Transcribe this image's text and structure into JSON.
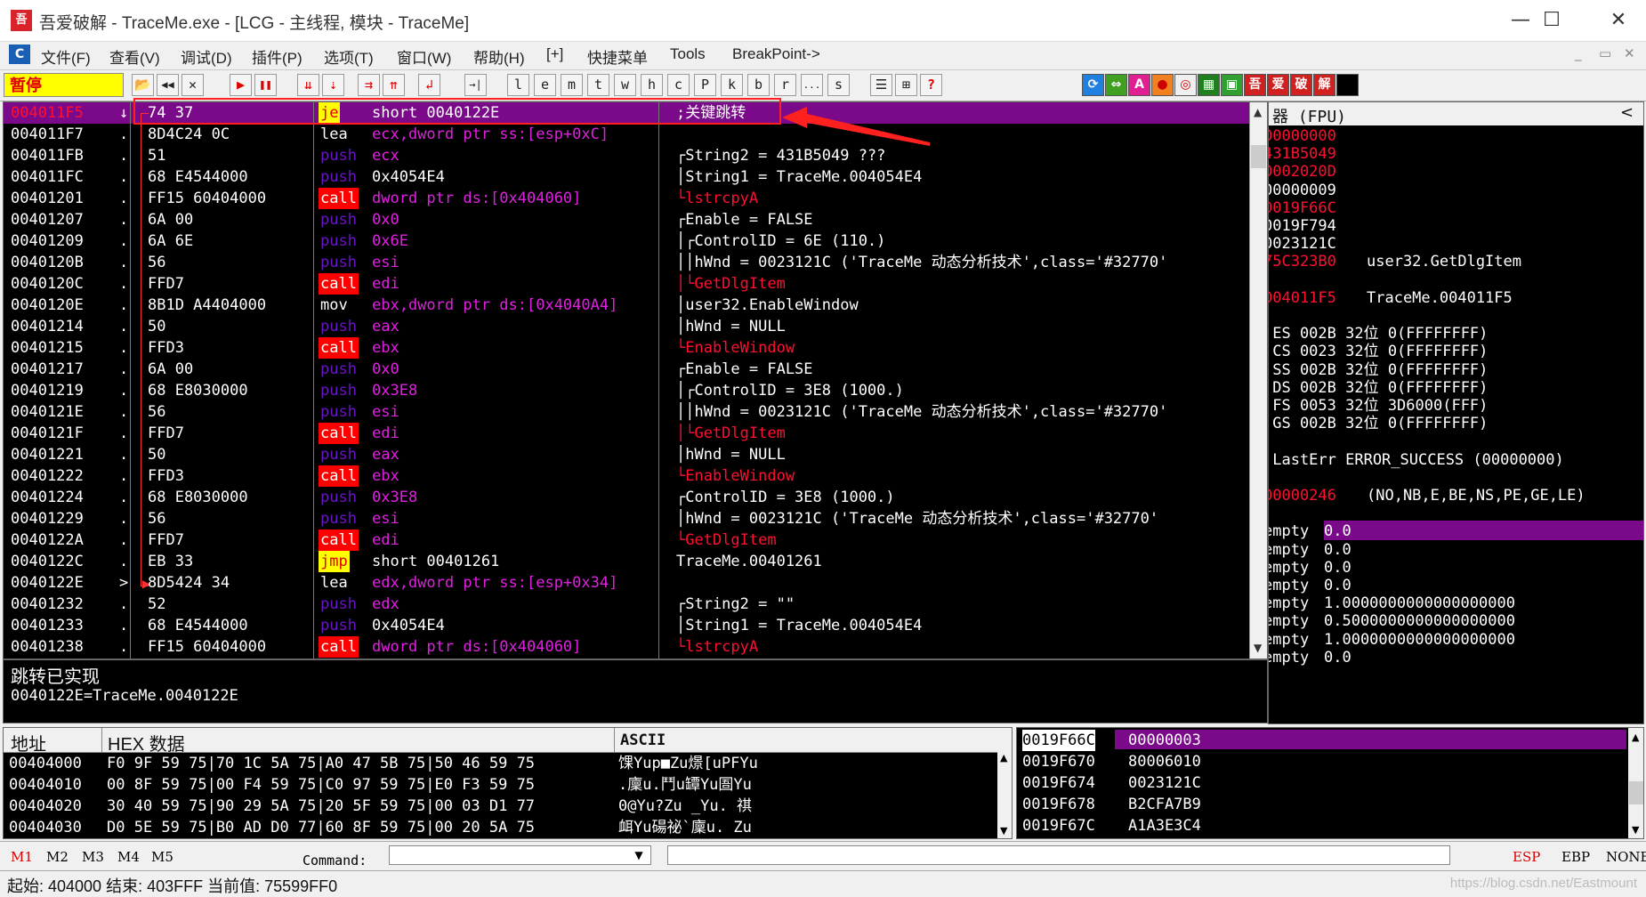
{
  "window": {
    "title": "吾爱破解 - TraceMe.exe - [LCG - 主线程, 模块 - TraceMe]",
    "icon": "吾",
    "minimize": "—",
    "maximize": "☐",
    "close": "✕"
  },
  "menu": {
    "logo": "C",
    "items": [
      "文件(F)",
      "查看(V)",
      "调试(D)",
      "插件(P)",
      "选项(T)",
      "窗口(W)",
      "帮助(H)",
      "[+]",
      "快捷菜单",
      "Tools",
      "BreakPoint->"
    ],
    "mdi": [
      "_",
      "▭",
      "✕"
    ]
  },
  "toolbar": {
    "status": "暂停",
    "buttons": [
      "📂",
      "◀◀",
      "✕",
      "▶",
      "❚❚",
      "⇊",
      "⇣",
      "⇉",
      "⇈",
      "↲",
      "→|"
    ],
    "letters": [
      "l",
      "e",
      "m",
      "t",
      "w",
      "h",
      "c",
      "P",
      "k",
      "b",
      "r",
      "...",
      "s"
    ],
    "right_buttons": [
      "☰",
      "⊞",
      "?"
    ],
    "plugins": [
      "⟳",
      "⇔",
      "A",
      "●",
      "◎",
      "▦",
      "▣",
      "吾",
      "爱",
      "破",
      "解",
      ""
    ]
  },
  "disasm": {
    "rows": [
      {
        "addr": "004011F5",
        "mark": "↓",
        "hex": "74 37",
        "mn": "je",
        "mk": "jcc",
        "op": "short 0040122E",
        "ok": "white",
        "cm": ";关键跳转",
        "ck": "white"
      },
      {
        "addr": "004011F7",
        "mark": ".",
        "hex": "8D4C24 0C",
        "mn": "lea",
        "mk": "lea",
        "op": "ecx,dword ptr ss:[esp+0xC]",
        "ok": "push",
        "cm": "",
        "ck": "white"
      },
      {
        "addr": "004011FB",
        "mark": ".",
        "hex": "51",
        "mn": "push",
        "mk": "push",
        "op": "ecx",
        "ok": "push",
        "cm": "┌String2 = 431B5049 ???",
        "ck": "white"
      },
      {
        "addr": "004011FC",
        "mark": ".",
        "hex": "68 E4544000",
        "mn": "push",
        "mk": "push",
        "op": "0x4054E4",
        "ok": "white",
        "cm": "│String1 = TraceMe.004054E4",
        "ck": "white"
      },
      {
        "addr": "00401201",
        "mark": ".",
        "hex": "FF15 60404000",
        "mn": "call",
        "mk": "call",
        "op": "dword ptr ds:[0x404060]",
        "ok": "push",
        "cm": "└lstrcpyA",
        "ck": "red"
      },
      {
        "addr": "00401207",
        "mark": ".",
        "hex": "6A 00",
        "mn": "push",
        "mk": "push",
        "op": "0x0",
        "ok": "push",
        "cm": "┌Enable = FALSE",
        "ck": "white"
      },
      {
        "addr": "00401209",
        "mark": ".",
        "hex": "6A 6E",
        "mn": "push",
        "mk": "push",
        "op": "0x6E",
        "ok": "push",
        "cm": "│┌ControlID = 6E (110.)",
        "ck": "white"
      },
      {
        "addr": "0040120B",
        "mark": ".",
        "hex": "56",
        "mn": "push",
        "mk": "push",
        "op": "esi",
        "ok": "push",
        "cm": "││hWnd = 0023121C ('TraceMe 动态分析技术',class='#32770'",
        "ck": "white"
      },
      {
        "addr": "0040120C",
        "mark": ".",
        "hex": "FFD7",
        "mn": "call",
        "mk": "call",
        "op": "edi",
        "ok": "push",
        "cm": "│└GetDlgItem",
        "ck": "red"
      },
      {
        "addr": "0040120E",
        "mark": ".",
        "hex": "8B1D A4404000",
        "mn": "mov",
        "mk": "mov",
        "op": "ebx,dword ptr ds:[0x4040A4]",
        "ok": "push",
        "cm": "│user32.EnableWindow",
        "ck": "white"
      },
      {
        "addr": "00401214",
        "mark": ".",
        "hex": "50",
        "mn": "push",
        "mk": "push",
        "op": "eax",
        "ok": "push",
        "cm": "│hWnd = NULL",
        "ck": "white"
      },
      {
        "addr": "00401215",
        "mark": ".",
        "hex": "FFD3",
        "mn": "call",
        "mk": "call",
        "op": "ebx",
        "ok": "push",
        "cm": "└EnableWindow",
        "ck": "red"
      },
      {
        "addr": "00401217",
        "mark": ".",
        "hex": "6A 00",
        "mn": "push",
        "mk": "push",
        "op": "0x0",
        "ok": "push",
        "cm": "┌Enable = FALSE",
        "ck": "white"
      },
      {
        "addr": "00401219",
        "mark": ".",
        "hex": "68 E8030000",
        "mn": "push",
        "mk": "push",
        "op": "0x3E8",
        "ok": "push",
        "cm": "│┌ControlID = 3E8 (1000.)",
        "ck": "white"
      },
      {
        "addr": "0040121E",
        "mark": ".",
        "hex": "56",
        "mn": "push",
        "mk": "push",
        "op": "esi",
        "ok": "push",
        "cm": "││hWnd = 0023121C ('TraceMe 动态分析技术',class='#32770'",
        "ck": "white"
      },
      {
        "addr": "0040121F",
        "mark": ".",
        "hex": "FFD7",
        "mn": "call",
        "mk": "call",
        "op": "edi",
        "ok": "push",
        "cm": "│└GetDlgItem",
        "ck": "red"
      },
      {
        "addr": "00401221",
        "mark": ".",
        "hex": "50",
        "mn": "push",
        "mk": "push",
        "op": "eax",
        "ok": "push",
        "cm": "│hWnd = NULL",
        "ck": "white"
      },
      {
        "addr": "00401222",
        "mark": ".",
        "hex": "FFD3",
        "mn": "call",
        "mk": "call",
        "op": "ebx",
        "ok": "push",
        "cm": "└EnableWindow",
        "ck": "red"
      },
      {
        "addr": "00401224",
        "mark": ".",
        "hex": "68 E8030000",
        "mn": "push",
        "mk": "push",
        "op": "0x3E8",
        "ok": "push",
        "cm": "┌ControlID = 3E8 (1000.)",
        "ck": "white"
      },
      {
        "addr": "00401229",
        "mark": ".",
        "hex": "56",
        "mn": "push",
        "mk": "push",
        "op": "esi",
        "ok": "push",
        "cm": "│hWnd = 0023121C ('TraceMe 动态分析技术',class='#32770'",
        "ck": "white"
      },
      {
        "addr": "0040122A",
        "mark": ".",
        "hex": "FFD7",
        "mn": "call",
        "mk": "call",
        "op": "edi",
        "ok": "push",
        "cm": "└GetDlgItem",
        "ck": "red"
      },
      {
        "addr": "0040122C",
        "mark": ".",
        "hex": "EB 33",
        "mn": "jmp",
        "mk": "jmp",
        "op": "short 00401261",
        "ok": "white",
        "cm": "TraceMe.00401261",
        "ck": "white"
      },
      {
        "addr": "0040122E",
        "mark": ">",
        "hex": "8D5424 34",
        "mn": "lea",
        "mk": "lea",
        "op": "edx,dword ptr ss:[esp+0x34]",
        "ok": "push",
        "cm": "",
        "ck": "white"
      },
      {
        "addr": "00401232",
        "mark": ".",
        "hex": "52",
        "mn": "push",
        "mk": "push",
        "op": "edx",
        "ok": "push",
        "cm": "┌String2 = \"\"",
        "ck": "white"
      },
      {
        "addr": "00401233",
        "mark": ".",
        "hex": "68 E4544000",
        "mn": "push",
        "mk": "push",
        "op": "0x4054E4",
        "ok": "white",
        "cm": "│String1 = TraceMe.004054E4",
        "ck": "white"
      },
      {
        "addr": "00401238",
        "mark": ".",
        "hex": "FF15 60404000",
        "mn": "call",
        "mk": "call",
        "op": "dword ptr ds:[0x404060]",
        "ok": "push",
        "cm": "└lstrcpyA",
        "ck": "red"
      }
    ]
  },
  "info": {
    "line1": "跳转已实现",
    "line2": "0040122E=TraceMe.0040122E"
  },
  "registers": {
    "header": "器 (FPU)",
    "collapse": "<",
    "rows": [
      {
        "a": "00000000",
        "b": "",
        "red": true
      },
      {
        "a": "431B5049",
        "b": "",
        "red": true
      },
      {
        "a": "0002020D",
        "b": "",
        "red": true
      },
      {
        "a": "00000009",
        "b": "",
        "red": false
      },
      {
        "a": "0019F66C",
        "b": "",
        "red": true
      },
      {
        "a": "0019F794",
        "b": "",
        "red": false
      },
      {
        "a": "0023121C",
        "b": "",
        "red": false
      },
      {
        "a": "75C323B0",
        "b": "user32.GetDlgItem",
        "red": true
      },
      {
        "a": "",
        "b": "",
        "red": false
      },
      {
        "a": "004011F5",
        "b": "TraceMe.004011F5",
        "red": true
      },
      {
        "a": "",
        "b": "",
        "red": false
      },
      {
        "a": " ES 002B 32位 0(FFFFFFFF)",
        "b": "",
        "red": false
      },
      {
        "a": " CS 0023 32位 0(FFFFFFFF)",
        "b": "",
        "red": false
      },
      {
        "a": " SS 002B 32位 0(FFFFFFFF)",
        "b": "",
        "red": false
      },
      {
        "a": " DS 002B 32位 0(FFFFFFFF)",
        "b": "",
        "red": false
      },
      {
        "a": " FS 0053 32位 3D6000(FFF)",
        "b": "",
        "red": false
      },
      {
        "a": " GS 002B 32位 0(FFFFFFFF)",
        "b": "",
        "red": false
      },
      {
        "a": "",
        "b": "",
        "red": false
      },
      {
        "a": " LastErr ERROR_SUCCESS (00000000)",
        "b": "",
        "red": false
      },
      {
        "a": "",
        "b": "",
        "red": false
      },
      {
        "a": "00000246",
        "b": "(NO,NB,E,BE,NS,PE,GE,LE)",
        "red": true
      },
      {
        "a": "",
        "b": "",
        "red": false
      },
      {
        "a": "empty",
        "b": "0.0",
        "red": false
      },
      {
        "a": "empty",
        "b": "0.0",
        "red": false
      },
      {
        "a": "empty",
        "b": "0.0",
        "red": false
      },
      {
        "a": "empty",
        "b": "0.0",
        "red": false
      },
      {
        "a": "empty",
        "b": "1.0000000000000000000",
        "red": false
      },
      {
        "a": "empty",
        "b": "0.5000000000000000000",
        "red": false
      },
      {
        "a": "empty",
        "b": "1.0000000000000000000",
        "red": false
      },
      {
        "a": "empty",
        "b": "0.0",
        "red": false
      }
    ]
  },
  "dump": {
    "headers": {
      "addr": "地址",
      "hex": "HEX 数据",
      "ascii": "ASCII"
    },
    "rows": [
      {
        "addr": "00404000",
        "hex": "F0 9F 59 75|70 1C 5A 75|A0 47 5B 75|50 46 59 75",
        "ascii": "馃Yup■Zu燝[uPFYu"
      },
      {
        "addr": "00404010",
        "hex": "00 8F 59 75|00 F4 59 75|C0 97 59 75|E0 F3 59 75",
        "ascii": ".廩u.鬥u罈Yu圄Yu"
      },
      {
        "addr": "00404020",
        "hex": "30 40 59 75|90 29 5A 75|20 5F 59 75|00 03 D1 77",
        "ascii": "0@Yu?Zu _Yu. 祺"
      },
      {
        "addr": "00404030",
        "hex": "D0 5E 59 75|B0 AD D0 77|60 8F 59 75|00 20 5A 75",
        "ascii": "衈Yu碭祕`廩u. Zu"
      }
    ]
  },
  "stack": {
    "rows": [
      {
        "addr": "0019F66C",
        "val": "00000003"
      },
      {
        "addr": "0019F670",
        "val": "80006010"
      },
      {
        "addr": "0019F674",
        "val": "0023121C"
      },
      {
        "addr": "0019F678",
        "val": "B2CFA7B9"
      },
      {
        "addr": "0019F67C",
        "val": "A1A3E3C4"
      }
    ]
  },
  "command": {
    "marks": [
      "M1",
      "M2",
      "M3",
      "M4",
      "M5"
    ],
    "label": "Command:",
    "input_value": "",
    "regs": [
      "ESP",
      "EBP",
      "NONE"
    ]
  },
  "status": {
    "text": "起始: 404000 结束: 403FFF 当前值: 75599FF0",
    "watermark": "https://blog.csdn.net/Eastmount"
  }
}
